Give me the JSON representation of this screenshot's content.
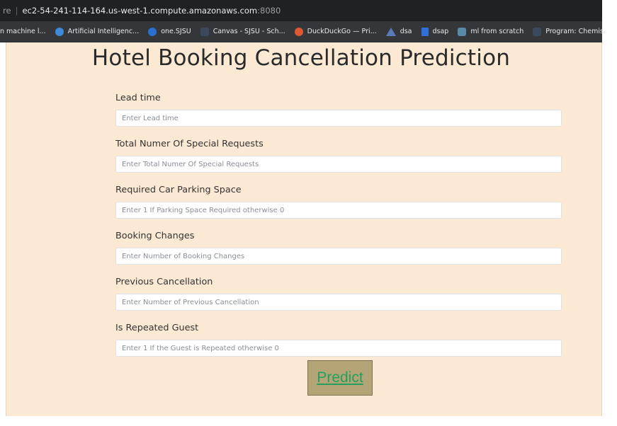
{
  "browser": {
    "url_prefix": "re",
    "url_host": "ec2-54-241-114-164.us-west-1.compute.amazonaws.com",
    "url_port": ":8080",
    "bookmarks": [
      {
        "label": "n machine l...",
        "icon": "none",
        "color": ""
      },
      {
        "label": "Artificial Intelligenc...",
        "icon": "globe-icon",
        "color": "#3d8bd8"
      },
      {
        "label": "one.SJSU",
        "icon": "circle-icon",
        "color": "#2a6fd0"
      },
      {
        "label": "Canvas - SJSU - Sch...",
        "icon": "book-icon",
        "color": "#3a4a5c"
      },
      {
        "label": "DuckDuckGo — Pri...",
        "icon": "duck-icon",
        "color": "#de5833"
      },
      {
        "label": "dsa",
        "icon": "triangle-icon",
        "color": "#5a7ab8"
      },
      {
        "label": "dsap",
        "icon": "doc-icon",
        "color": "#2f6fd8"
      },
      {
        "label": "ml from scratch",
        "icon": "image-icon",
        "color": "#5a8aa8"
      },
      {
        "label": "Program: Chemistry...",
        "icon": "book-icon",
        "color": "#3a4a5c"
      }
    ]
  },
  "page": {
    "title": "Hotel Booking Cancellation Prediction",
    "background": "#fbe9d4",
    "fields": [
      {
        "label": "Lead time",
        "placeholder": "Enter Lead time",
        "value": ""
      },
      {
        "label": "Total Numer Of Special Requests",
        "placeholder": "Enter Total Numer Of Special Requests",
        "value": ""
      },
      {
        "label": "Required Car Parking Space",
        "placeholder": "Enter 1 If Parking Space Required otherwise 0",
        "value": ""
      },
      {
        "label": "Booking Changes",
        "placeholder": "Enter Number of Booking Changes",
        "value": ""
      },
      {
        "label": "Previous Cancellation",
        "placeholder": "Enter Number of Previous Cancellation",
        "value": ""
      },
      {
        "label": "Is Repeated Guest",
        "placeholder": "Enter 1 If the Guest is Repeated otherwise 0",
        "value": ""
      }
    ],
    "submit_label": "Predict",
    "button_color": "#b5a576",
    "button_text_color": "#22a060"
  }
}
